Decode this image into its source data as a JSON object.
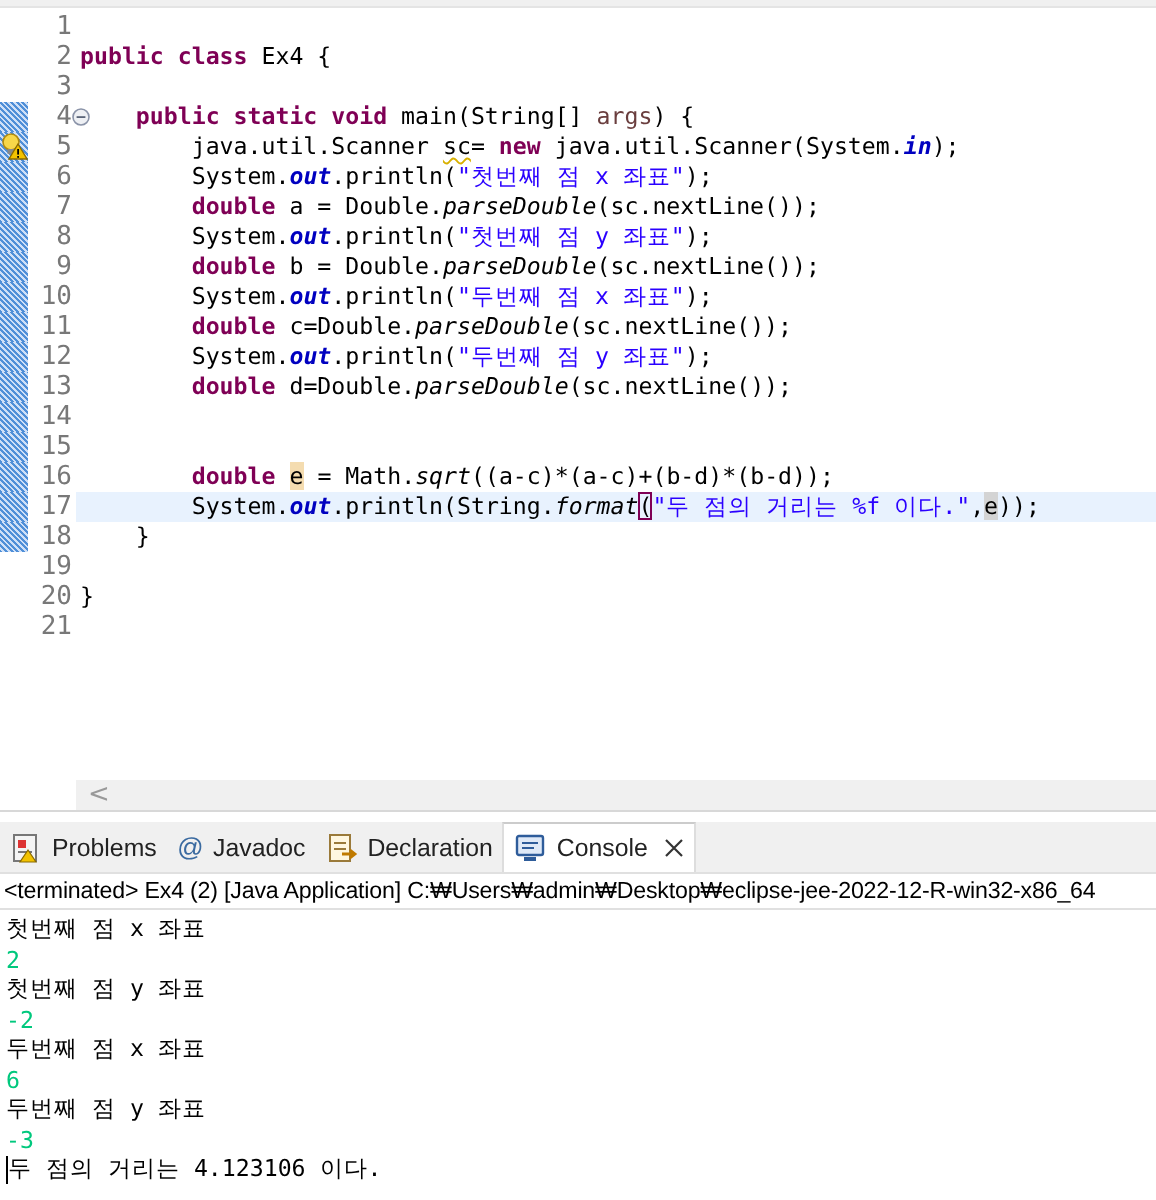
{
  "editor": {
    "lines": [
      {
        "number": "1",
        "kind": "plain",
        "changed": false,
        "current": false
      },
      {
        "number": "2",
        "kind": "plain",
        "changed": false,
        "current": false,
        "tokens": [
          {
            "t": "public class ",
            "kind": "kw"
          },
          {
            "t": "Ex4 {",
            "kind": "text"
          }
        ]
      },
      {
        "number": "3",
        "kind": "plain",
        "changed": false,
        "current": false
      },
      {
        "number": "4",
        "kind": "fold",
        "changed": true,
        "current": false,
        "tokens": [
          {
            "t": "    public static void ",
            "kind": "kw"
          },
          {
            "t": "main(String[] ",
            "kind": "text"
          },
          {
            "t": "args",
            "kind": "param"
          },
          {
            "t": ") {",
            "kind": "text"
          }
        ]
      },
      {
        "number": "5",
        "kind": "warning",
        "changed": true,
        "current": false,
        "tokens": [
          {
            "t": "        java.util.Scanner ",
            "kind": "text"
          },
          {
            "t": "sc",
            "kind": "warn"
          },
          {
            "t": "= ",
            "kind": "text"
          },
          {
            "t": "new ",
            "kind": "kw"
          },
          {
            "t": "java.util.Scanner(System.",
            "kind": "text"
          },
          {
            "t": "in",
            "kind": "field"
          },
          {
            "t": ");",
            "kind": "text"
          }
        ]
      },
      {
        "number": "6",
        "kind": "plain",
        "changed": true,
        "current": false,
        "tokens": [
          {
            "t": "        System.",
            "kind": "text"
          },
          {
            "t": "out",
            "kind": "field"
          },
          {
            "t": ".println(",
            "kind": "text"
          },
          {
            "t": "\"첫번째 점 x 좌표\"",
            "kind": "string"
          },
          {
            "t": ");",
            "kind": "text"
          }
        ]
      },
      {
        "number": "7",
        "kind": "plain",
        "changed": true,
        "current": false,
        "tokens": [
          {
            "t": "        double ",
            "kind": "kw"
          },
          {
            "t": "a = Double.",
            "kind": "text"
          },
          {
            "t": "parseDouble",
            "kind": "static"
          },
          {
            "t": "(sc.nextLine());",
            "kind": "text"
          }
        ]
      },
      {
        "number": "8",
        "kind": "plain",
        "changed": true,
        "current": false,
        "tokens": [
          {
            "t": "        System.",
            "kind": "text"
          },
          {
            "t": "out",
            "kind": "field"
          },
          {
            "t": ".println(",
            "kind": "text"
          },
          {
            "t": "\"첫번째 점 y 좌표\"",
            "kind": "string"
          },
          {
            "t": ");",
            "kind": "text"
          }
        ]
      },
      {
        "number": "9",
        "kind": "plain",
        "changed": true,
        "current": false,
        "tokens": [
          {
            "t": "        double ",
            "kind": "kw"
          },
          {
            "t": "b = Double.",
            "kind": "text"
          },
          {
            "t": "parseDouble",
            "kind": "static"
          },
          {
            "t": "(sc.nextLine());",
            "kind": "text"
          }
        ]
      },
      {
        "number": "10",
        "kind": "plain",
        "changed": true,
        "current": false,
        "tokens": [
          {
            "t": "        System.",
            "kind": "text"
          },
          {
            "t": "out",
            "kind": "field"
          },
          {
            "t": ".println(",
            "kind": "text"
          },
          {
            "t": "\"두번째 점 x 좌표\"",
            "kind": "string"
          },
          {
            "t": ");",
            "kind": "text"
          }
        ]
      },
      {
        "number": "11",
        "kind": "plain",
        "changed": true,
        "current": false,
        "tokens": [
          {
            "t": "        double ",
            "kind": "kw"
          },
          {
            "t": "c=Double.",
            "kind": "text"
          },
          {
            "t": "parseDouble",
            "kind": "static"
          },
          {
            "t": "(sc.nextLine());",
            "kind": "text"
          }
        ]
      },
      {
        "number": "12",
        "kind": "plain",
        "changed": true,
        "current": false,
        "tokens": [
          {
            "t": "        System.",
            "kind": "text"
          },
          {
            "t": "out",
            "kind": "field"
          },
          {
            "t": ".println(",
            "kind": "text"
          },
          {
            "t": "\"두번째 점 y 좌표\"",
            "kind": "string"
          },
          {
            "t": ");",
            "kind": "text"
          }
        ]
      },
      {
        "number": "13",
        "kind": "plain",
        "changed": true,
        "current": false,
        "tokens": [
          {
            "t": "        double ",
            "kind": "kw"
          },
          {
            "t": "d=Double.",
            "kind": "text"
          },
          {
            "t": "parseDouble",
            "kind": "static"
          },
          {
            "t": "(sc.nextLine());",
            "kind": "text"
          }
        ]
      },
      {
        "number": "14",
        "kind": "plain",
        "changed": true,
        "current": false
      },
      {
        "number": "15",
        "kind": "plain",
        "changed": true,
        "current": false
      },
      {
        "number": "16",
        "kind": "plain",
        "changed": true,
        "current": false,
        "tokens": [
          {
            "t": "        double ",
            "kind": "kw"
          },
          {
            "t": "e",
            "kind": "write"
          },
          {
            "t": " = Math.",
            "kind": "text"
          },
          {
            "t": "sqrt",
            "kind": "static"
          },
          {
            "t": "((a-c)*(a-c)+(b-d)*(b-d));",
            "kind": "text"
          }
        ]
      },
      {
        "number": "17",
        "kind": "plain",
        "changed": true,
        "current": true,
        "tokens": [
          {
            "t": "        System.",
            "kind": "text"
          },
          {
            "t": "out",
            "kind": "field"
          },
          {
            "t": ".println(String.",
            "kind": "text"
          },
          {
            "t": "format",
            "kind": "static"
          },
          {
            "t": "(",
            "kind": "bracket"
          },
          {
            "t": "\"두 점의 거리는 %f 이다.\"",
            "kind": "string"
          },
          {
            "t": ",",
            "kind": "text"
          },
          {
            "t": "e",
            "kind": "read"
          },
          {
            "t": "));",
            "kind": "text"
          }
        ]
      },
      {
        "number": "18",
        "kind": "plain",
        "changed": true,
        "current": false,
        "tokens": [
          {
            "t": "    }",
            "kind": "text"
          }
        ]
      },
      {
        "number": "19",
        "kind": "plain",
        "changed": false,
        "current": false
      },
      {
        "number": "20",
        "kind": "plain",
        "changed": false,
        "current": false,
        "tokens": [
          {
            "t": "}",
            "kind": "text"
          }
        ]
      },
      {
        "number": "21",
        "kind": "plain",
        "changed": false,
        "current": false
      }
    ],
    "scroll_left": "<"
  },
  "panel": {
    "tabs": [
      {
        "label": "Problems",
        "kind": "problems",
        "selected": false
      },
      {
        "label": "Javadoc",
        "kind": "javadoc",
        "glyph": "@",
        "selected": false
      },
      {
        "label": "Declaration",
        "kind": "declaration",
        "selected": false
      },
      {
        "label": "Console",
        "kind": "console",
        "selected": true
      }
    ],
    "console_header": "<terminated> Ex4 (2) [Java Application] C:₩Users₩admin₩Desktop₩eclipse-jee-2022-12-R-win32-x86_64",
    "output": [
      {
        "text": "첫번째 점 x 좌표",
        "kind": "out",
        "cursor": false
      },
      {
        "text": "2",
        "kind": "in",
        "cursor": false
      },
      {
        "text": "첫번째 점 y 좌표",
        "kind": "out",
        "cursor": false
      },
      {
        "text": "-2",
        "kind": "in",
        "cursor": false
      },
      {
        "text": "두번째 점 x 좌표",
        "kind": "out",
        "cursor": false
      },
      {
        "text": "6",
        "kind": "in",
        "cursor": false
      },
      {
        "text": "두번째 점 y 좌표",
        "kind": "out",
        "cursor": false
      },
      {
        "text": "-3",
        "kind": "in",
        "cursor": false
      },
      {
        "text": "두 점의 거리는 4.123106 이다.",
        "kind": "out",
        "cursor": true
      }
    ]
  }
}
